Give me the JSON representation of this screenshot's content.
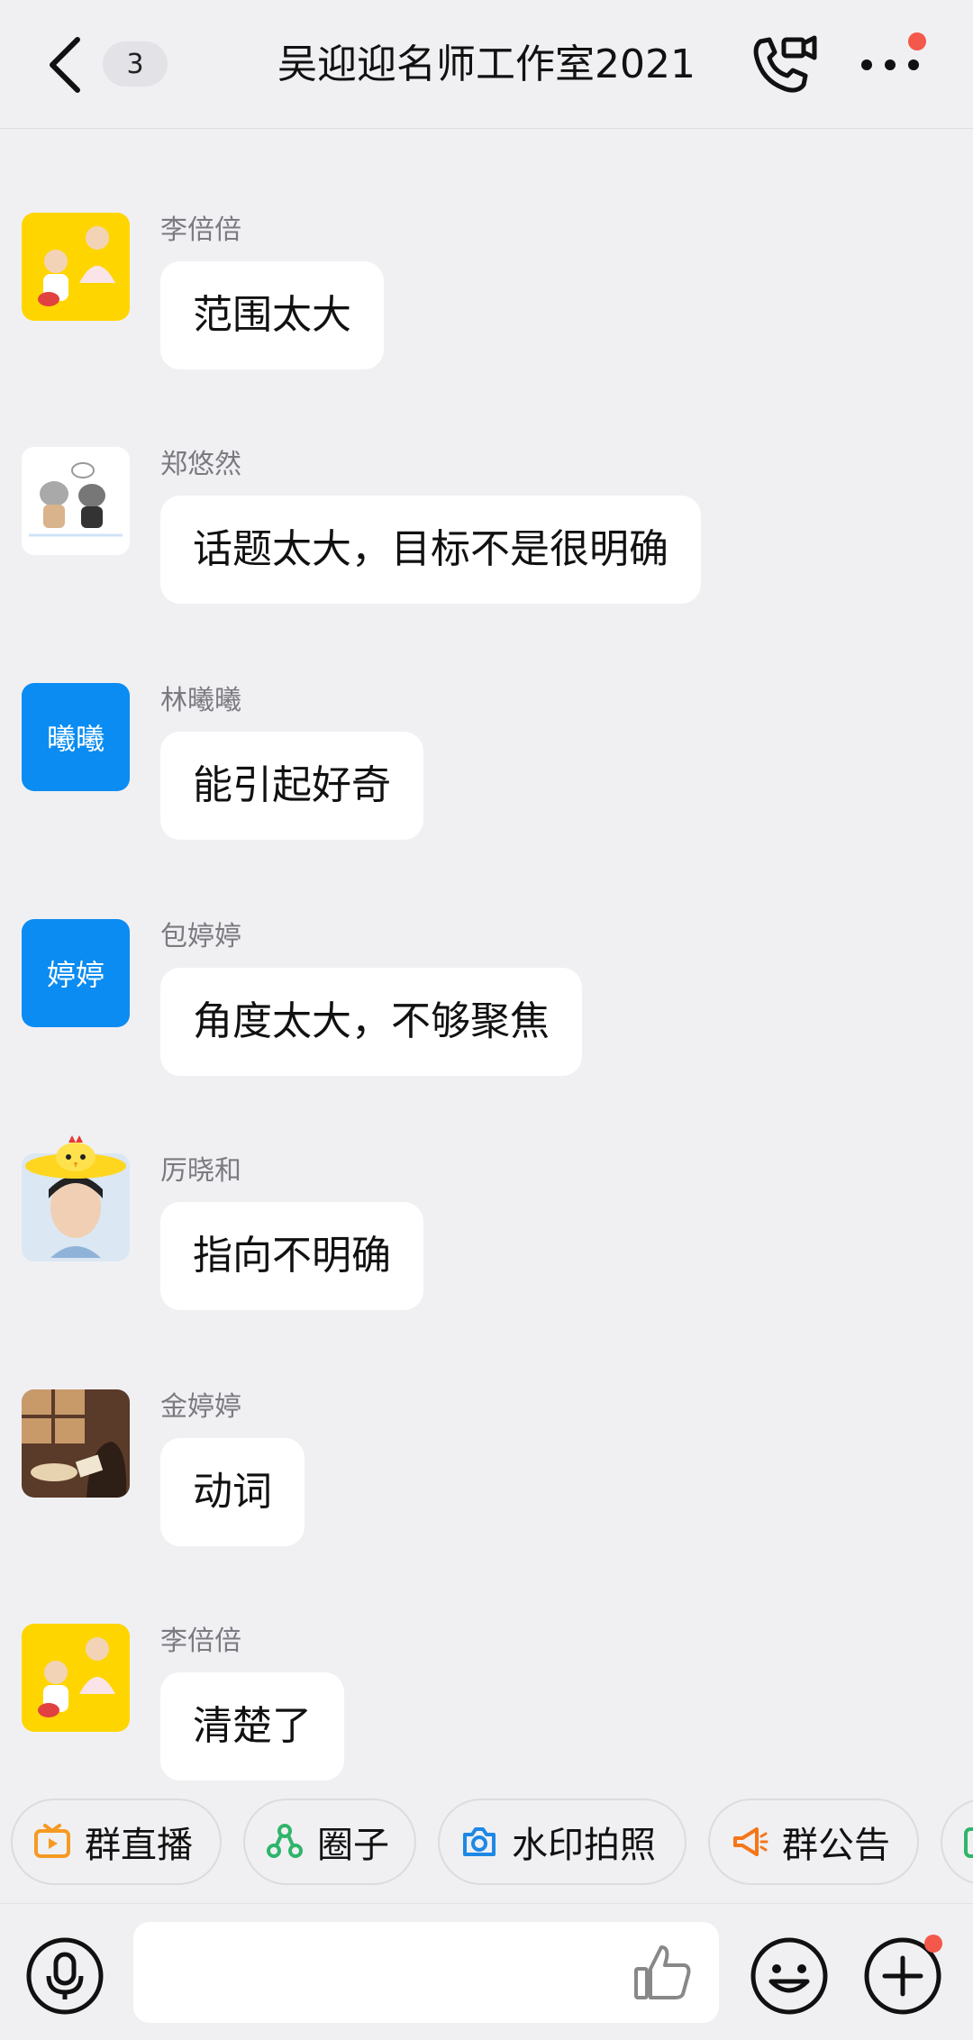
{
  "header": {
    "unread_count": "3",
    "title": "吴迎迎名师工作室2021"
  },
  "messages": [
    {
      "sender": "李倍倍",
      "text": "范围太大",
      "avatar": {
        "type": "image",
        "name": "kids-photo-avatar"
      }
    },
    {
      "sender": "郑悠然",
      "text": "话题太大，目标不是很明确",
      "avatar": {
        "type": "image",
        "name": "cartoon-cats-avatar"
      }
    },
    {
      "sender": "林曦曦",
      "text": "能引起好奇",
      "avatar": {
        "type": "text",
        "label": "曦曦",
        "color": "#0a8cf2"
      }
    },
    {
      "sender": "包婷婷",
      "text": "角度太大，不够聚焦",
      "avatar": {
        "type": "text",
        "label": "婷婷",
        "color": "#0a8cf2"
      }
    },
    {
      "sender": "厉晓和",
      "text": "指向不明确",
      "avatar": {
        "type": "image",
        "name": "woman-chick-hat-avatar"
      }
    },
    {
      "sender": "金婷婷",
      "text": "动词",
      "avatar": {
        "type": "image",
        "name": "reading-illustration-avatar"
      }
    },
    {
      "sender": "李倍倍",
      "text": "清楚了",
      "avatar": {
        "type": "image",
        "name": "kids-photo-avatar"
      }
    }
  ],
  "quick_actions": [
    {
      "label": "群直播",
      "icon": "tv-icon",
      "color": "#f59a23"
    },
    {
      "label": "圈子",
      "icon": "circle-nodes-icon",
      "color": "#2fb56a"
    },
    {
      "label": "水印拍照",
      "icon": "camera-icon",
      "color": "#1e88e5"
    },
    {
      "label": "群公告",
      "icon": "megaphone-icon",
      "color": "#f5761a"
    }
  ],
  "colors": {
    "background": "#f0f0f3",
    "bubble": "#ffffff",
    "badge_red": "#f4584a"
  }
}
